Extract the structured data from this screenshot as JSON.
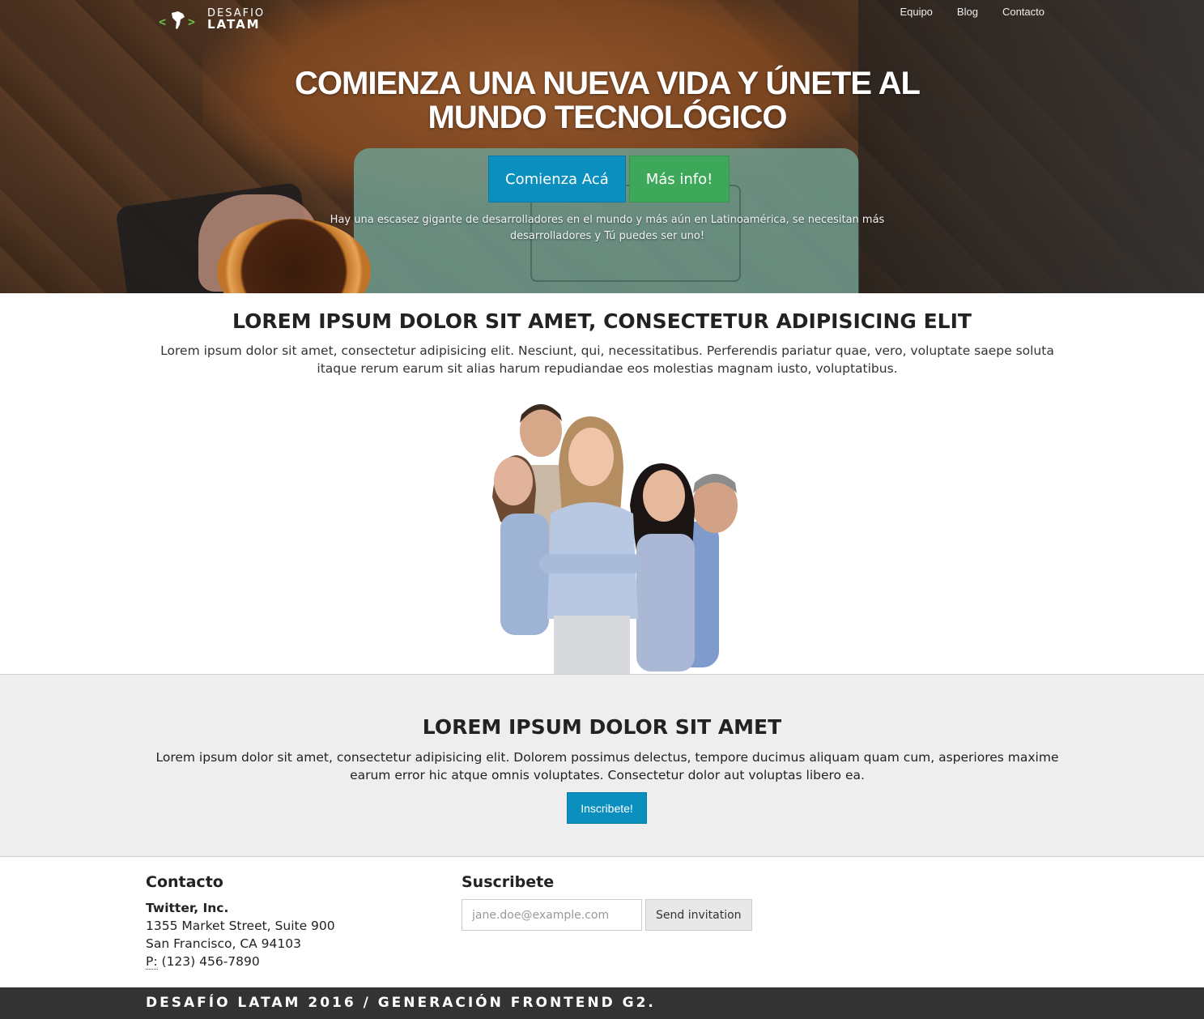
{
  "brand": {
    "logo_top": "DESAFIO",
    "logo_bottom": "LATAM",
    "accent": "#6ac045"
  },
  "nav": {
    "items": [
      {
        "label": "Equipo"
      },
      {
        "label": "Blog"
      },
      {
        "label": "Contacto"
      }
    ]
  },
  "hero": {
    "title": "COMIENZA UNA NUEVA VIDA Y ÚNETE AL MUNDO TECNOLÓGICO",
    "primary_button": "Comienza Acá",
    "secondary_button": "Más info!",
    "tagline": "Hay una escasez gigante de desarrolladores en el mundo y más aún en Latinoamérica, se necesitan más desarrolladores y Tú puedes ser uno!"
  },
  "section1": {
    "title": "LOREM IPSUM DOLOR SIT AMET, CONSECTETUR ADIPISICING ELIT",
    "text": "Lorem ipsum dolor sit amet, consectetur adipisicing elit. Nesciunt, qui, necessitatibus. Perferendis pariatur quae, vero, voluptate saepe soluta itaque rerum earum sit alias harum repudiandae eos molestias magnam iusto, voluptatibus."
  },
  "section2": {
    "title": "LOREM IPSUM DOLOR SIT AMET",
    "text": "Lorem ipsum dolor sit amet, consectetur adipisicing elit. Dolorem possimus delectus, tempore ducimus aliquam quam cum, asperiores maxime earum error hic atque omnis voluptates. Consectetur dolor aut voluptas libero ea.",
    "button": "Inscribete!"
  },
  "contact": {
    "title": "Contacto",
    "company": "Twitter, Inc.",
    "street": "1355 Market Street, Suite 900",
    "city": "San Francisco, CA 94103",
    "phone_label": "P:",
    "phone": "(123) 456-7890"
  },
  "subscribe": {
    "title": "Suscribete",
    "email_placeholder": "jane.doe@example.com",
    "button": "Send invitation"
  },
  "footer": {
    "text": "DESAFÍO LATAM 2016 / GENERACIÓN FRONTEND G2."
  },
  "colors": {
    "primary": "#0a8fbf",
    "success": "#3ea85a",
    "footer_bg": "#333333",
    "section_bg": "#eeeeee"
  }
}
